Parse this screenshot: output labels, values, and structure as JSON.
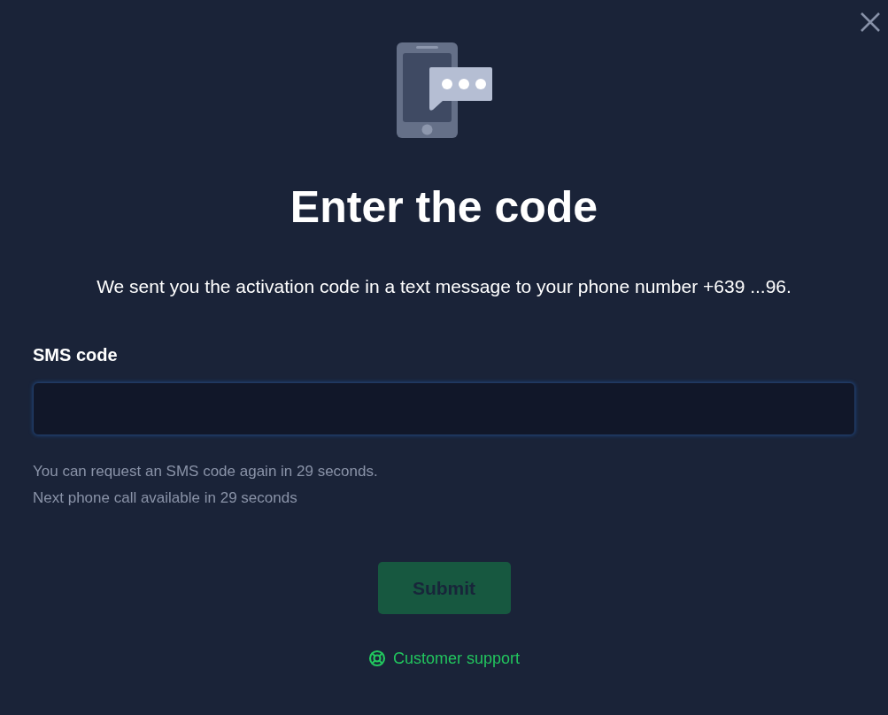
{
  "title": "Enter the code",
  "message": "We sent you the activation code in a text message to your phone number +639 ...96.",
  "field": {
    "label": "SMS code"
  },
  "hints": [
    "You can request an SMS code again in 29 seconds.",
    "Next phone call available in 29 seconds"
  ],
  "submit": {
    "label": "Submit",
    "disabled": true
  },
  "support_link": "Customer support"
}
